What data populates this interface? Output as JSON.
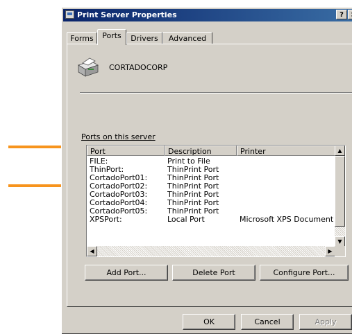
{
  "window": {
    "title": "Print Server Properties",
    "help_glyph": "?",
    "close_glyph": "×"
  },
  "tabs": [
    {
      "label": "Forms"
    },
    {
      "label": "Ports",
      "active": true
    },
    {
      "label": "Drivers"
    },
    {
      "label": "Advanced"
    }
  ],
  "server": {
    "name": "CORTADOCORP",
    "icon": "printer-icon"
  },
  "ports_label": "Ports on this server",
  "table": {
    "columns": [
      "Port",
      "Description",
      "Printer"
    ],
    "rows": [
      {
        "port": "FILE:",
        "description": "Print to File",
        "printer": ""
      },
      {
        "port": "ThinPort:",
        "description": "ThinPrint Port",
        "printer": ""
      },
      {
        "port": "CortadoPort01:",
        "description": "ThinPrint Port",
        "printer": ""
      },
      {
        "port": "CortadoPort02:",
        "description": "ThinPrint Port",
        "printer": ""
      },
      {
        "port": "CortadoPort03:",
        "description": "ThinPrint Port",
        "printer": ""
      },
      {
        "port": "CortadoPort04:",
        "description": "ThinPrint Port",
        "printer": ""
      },
      {
        "port": "CortadoPort05:",
        "description": "ThinPrint Port",
        "printer": ""
      },
      {
        "port": "XPSPort:",
        "description": "Local Port",
        "printer": "Microsoft XPS Document W"
      }
    ]
  },
  "buttons": {
    "add_port": "Add Port...",
    "delete_port": "Delete Port",
    "configure_port": "Configure Port...",
    "ok": "OK",
    "cancel": "Cancel",
    "apply": "Apply"
  },
  "colors": {
    "annotation_arrow": "#f7941d",
    "titlebar": "#0a246a"
  }
}
